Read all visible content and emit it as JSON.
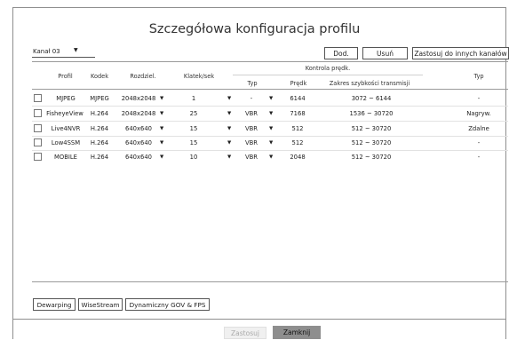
{
  "title": "Szczegółowa konfiguracja profilu",
  "channel": {
    "value": "Kanał 03",
    "arrow": "▼"
  },
  "toolbar": {
    "add": "Dod.",
    "remove": "Usuń",
    "apply_other": "Zastosuj do innych kanałów"
  },
  "columns": {
    "profile": "Profil",
    "codec": "Kodek",
    "resolution": "Rozdziel.",
    "fps": "Klatek/sek",
    "rate_control": "Kontrola prędk.",
    "type": "Typ",
    "speed": "Prędk",
    "bitrate_range": "Zakres szybkości transmisji",
    "type2": "Typ"
  },
  "rows": [
    {
      "profile": "MJPEG",
      "codec": "MJPEG",
      "resolution": "2048x2048",
      "fps": "1",
      "type": "-",
      "speed": "6144",
      "range": "3072 ~ 6144",
      "type2": "-"
    },
    {
      "profile": "FisheyeView",
      "codec": "H.264",
      "resolution": "2048x2048",
      "fps": "25",
      "type": "VBR",
      "speed": "7168",
      "range": "1536 ~ 30720",
      "type2": "Nagryw."
    },
    {
      "profile": "Live4NVR",
      "codec": "H.264",
      "resolution": "640x640",
      "fps": "15",
      "type": "VBR",
      "speed": "512",
      "range": "512 ~ 30720",
      "type2": "Zdalne"
    },
    {
      "profile": "Low4SSM",
      "codec": "H.264",
      "resolution": "640x640",
      "fps": "15",
      "type": "VBR",
      "speed": "512",
      "range": "512 ~ 30720",
      "type2": "-"
    },
    {
      "profile": "MOBILE",
      "codec": "H.264",
      "resolution": "640x640",
      "fps": "10",
      "type": "VBR",
      "speed": "2048",
      "range": "512 ~ 30720",
      "type2": "-"
    }
  ],
  "dropdown_glyph": "▼",
  "bottom_buttons": {
    "dewarping": "Dewarping",
    "wisestream": "WiseStream",
    "dynamic_gov": "Dynamiczny GOV & FPS"
  },
  "footer": {
    "apply": "Zastosuj",
    "close": "Zamknij"
  },
  "colors": {
    "close_button_bg": "#8e8e8e",
    "border": "#555555"
  }
}
